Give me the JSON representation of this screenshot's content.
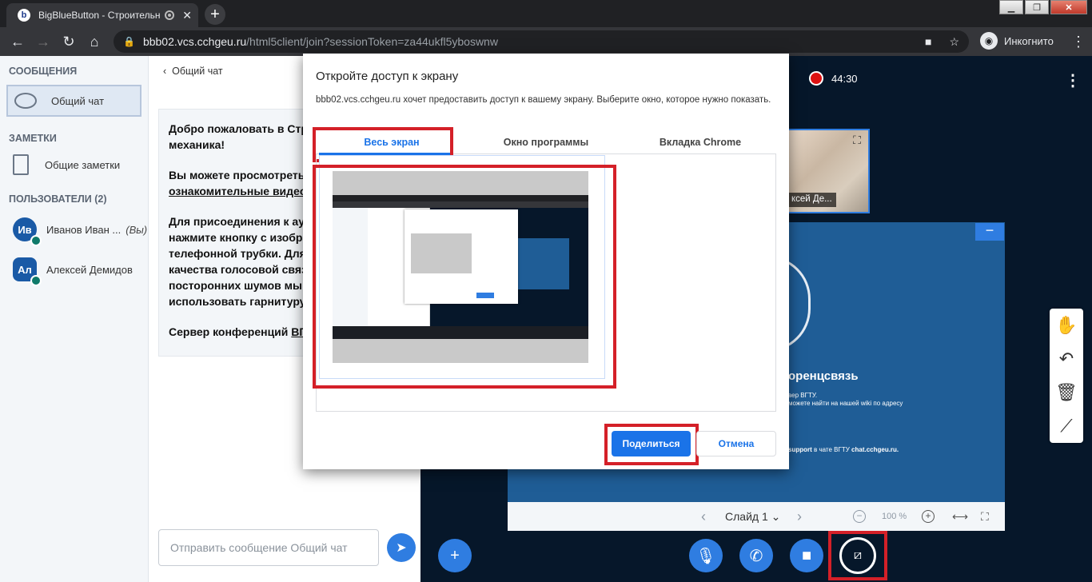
{
  "browser": {
    "tab_title": "BigBlueButton - Строительн",
    "favicon_letter": "b",
    "new_tab": "+",
    "url_host": "bbb02.vcs.cchgeu.ru",
    "url_path": "/html5client/join?sessionToken=za44ukfl5yboswnw",
    "incognito_label": "Инкогнито",
    "icons": [
      "back-icon",
      "forward-icon",
      "reload-icon",
      "home-icon",
      "lock-icon",
      "camera-blocked-icon",
      "star-icon",
      "incognito-icon",
      "more-icon"
    ]
  },
  "sidebar": {
    "messages_title": "СООБЩЕНИЯ",
    "public_chat": "Общий чат",
    "notes_title": "ЗАМЕТКИ",
    "shared_notes": "Общие заметки",
    "users_title": "ПОЛЬЗОВАТЕЛИ (2)",
    "users": [
      {
        "initials": "Ив",
        "name": "Иванов Иван ...",
        "you": "(Вы)"
      },
      {
        "initials": "Ал",
        "name": "Алексей Демидов"
      }
    ]
  },
  "chat": {
    "header": "Общий чат",
    "welcome_line1_a": "Добро пожаловать в ",
    "welcome_line1_b": "Стр",
    "welcome_line2": "механика",
    "welcome_p2_line1": "Вы можете просмотреть",
    "welcome_p2_line2": "ознакомительные видео",
    "welcome_p3": [
      "Для присоединения к ауд",
      "нажмите кнопку с изобра",
      "телефонной трубки. Для",
      "качества голосовой связ",
      "посторонних шумов мы",
      "использовать гарнитуру"
    ],
    "welcome_p4_a": "Сервер конференций ",
    "welcome_p4_b": "ВГ",
    "input_placeholder": "Отправить сообщение Общий чат"
  },
  "presentation": {
    "recording_time": "44:30",
    "webcam_name": "ксей Де...",
    "slide_heading": "оренцсвязь",
    "slide_text1": "вер ВГТУ.",
    "slide_text2": "можете найти на нашей wiki по адресу",
    "slide_text3_a": "support",
    "slide_text3_b": " в чате ВГТУ ",
    "slide_text3_c": "chat.cchgeu.ru.",
    "slide_selector": "Слайд 1",
    "zoom": "100 %"
  },
  "dialog": {
    "title": "Откройте доступ к экрану",
    "description": "bbb02.vcs.cchgeu.ru хочет предоставить доступ к вашему экрану. Выберите окно, которое нужно показать.",
    "tabs": [
      "Весь экран",
      "Окно программы",
      "Вкладка Chrome"
    ],
    "active_tab": 0,
    "share_button": "Поделиться",
    "cancel_button": "Отмена"
  },
  "colors": {
    "accent": "#2f7de1",
    "highlight_red": "#d42028",
    "background_dark": "#06172a",
    "slide_blue": "#1f5d96"
  }
}
